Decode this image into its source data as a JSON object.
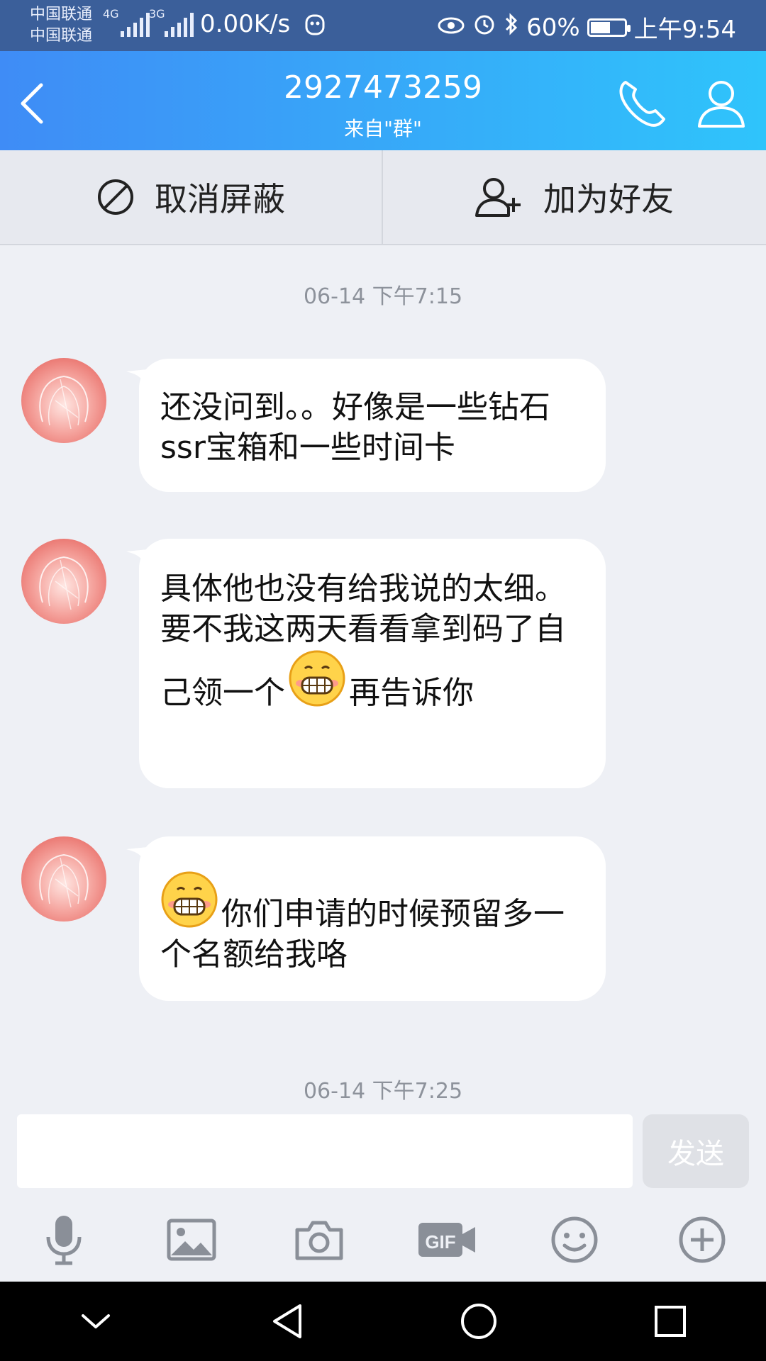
{
  "status_bar": {
    "carrier_1": "中国联通",
    "carrier_2": "中国联通",
    "network_1": "4G",
    "network_2": "3G",
    "speed": "0.00K/s",
    "battery": "60%",
    "battery_level": 0.6,
    "time": "上午9:54"
  },
  "header": {
    "title": "2927473259",
    "subtitle": "来自\"群\"",
    "gradient": [
      "#3f8cf6",
      "#2fc4fb"
    ]
  },
  "actions": {
    "unblock_label": "取消屏蔽",
    "add_friend_label": "加为好友"
  },
  "messages": {
    "timestamp_1": "06-14 下午7:15",
    "msg_1": "还没问到。。好像是一些钻石 ssr宝箱和一些时间卡",
    "msg_2_part_1": "具体他也没有给我说的太细。要不我这两天看看拿到码了自己领一个",
    "msg_2_part_2": "再告诉你",
    "msg_3": "你们申请的时候预留多一个名额给我咯",
    "timestamp_2": "06-14 下午7:25"
  },
  "composer": {
    "input_value": "",
    "send_label": "发送"
  },
  "toolbar": {
    "icons": [
      "microphone-icon",
      "image-icon",
      "camera-icon",
      "gif-icon",
      "emoji-icon",
      "plus-icon"
    ]
  },
  "navigation": {
    "icons": [
      "chevron-down-icon",
      "back-triangle-icon",
      "home-circle-icon",
      "recents-square-icon"
    ]
  }
}
